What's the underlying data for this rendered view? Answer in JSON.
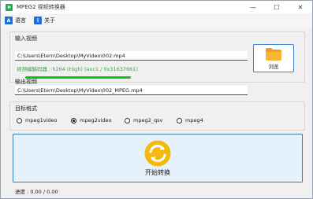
{
  "window": {
    "title": "MPEG2 视频转换器",
    "minimize_glyph": "—",
    "maximize_glyph": "☐",
    "close_glyph": "✕"
  },
  "menu": {
    "language_label": "语言",
    "language_icon_text": "A",
    "about_label": "关于",
    "about_icon_text": "i"
  },
  "input_group": {
    "label": "输入视频",
    "path": "C:\\Users\\Etern\\Desktop\\MyVideo\\002.mp4",
    "codec_info": "视频编解码器 : h264 (High) (avc1 / 0x31637661)",
    "browse_label": "浏览"
  },
  "output_group": {
    "label": "输出视频",
    "path": "C:\\Users\\Etern\\Desktop\\MyVideo\\002_MPEG.mp4"
  },
  "format_group": {
    "label": "目标格式",
    "options": [
      {
        "label": "mpeg1video",
        "checked": false
      },
      {
        "label": "mpeg2video",
        "checked": true
      },
      {
        "label": "mpeg2_qsv",
        "checked": false
      },
      {
        "label": "mpeg4",
        "checked": false
      }
    ]
  },
  "start": {
    "label": "开始转换"
  },
  "progress": {
    "text": "进度 : 0.00 / 0.00"
  },
  "colors": {
    "accent_blue": "#3c7fb1",
    "codec_green": "#37a54a",
    "icon_yellow": "#f5b90e",
    "folder_orange": "#f7a823"
  }
}
